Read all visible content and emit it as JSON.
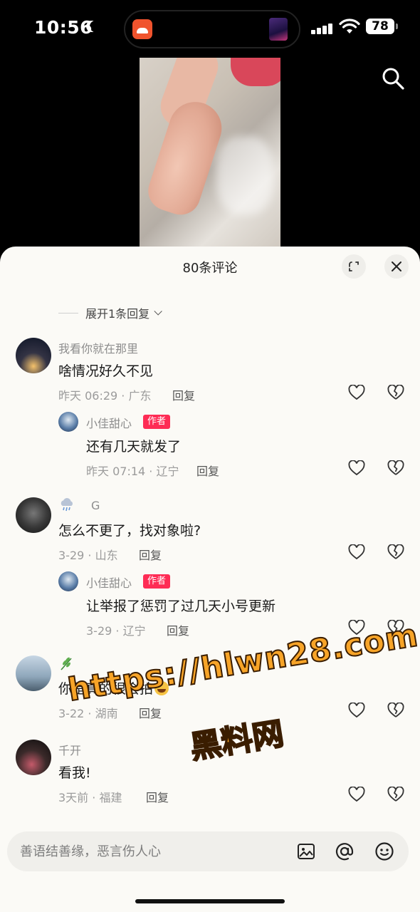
{
  "status_bar": {
    "time": "10:56",
    "battery": "78"
  },
  "sheet": {
    "title": "80条评论",
    "expand_replies": "展开1条回复"
  },
  "comments": [
    {
      "user": "我看你就在那里",
      "text": "啥情况好久不见",
      "meta": "昨天 06:29 · 广东",
      "reply_label": "回复"
    },
    {
      "user": "小佳甜心",
      "badge": "作者",
      "text": "还有几天就发了",
      "meta": "昨天 07:14 · 辽宁",
      "reply_label": "回复"
    },
    {
      "user": "G",
      "text": "怎么不更了，找对象啦?",
      "meta": "3-29 · 山东",
      "reply_label": "回复"
    },
    {
      "user": "小佳甜心",
      "badge": "作者",
      "text": "让举报了惩罚了过几天小号更新",
      "meta": "3-29 · 辽宁",
      "reply_label": "回复"
    },
    {
      "user": "",
      "text": "你是真的很会拍",
      "meta": "3-22 · 湖南",
      "reply_label": "回复"
    },
    {
      "user": "千开",
      "text": "看我!",
      "meta": "3天前 · 福建",
      "reply_label": "回复"
    }
  ],
  "watermark": {
    "line1": "https://hlwn28.com",
    "line2": "黑料网"
  },
  "input": {
    "placeholder": "善语结善缘，恶言伤人心"
  },
  "colors": {
    "accent": "#fe2c55",
    "sheet_bg": "#fbfaf6",
    "watermark": "#f7a428"
  }
}
